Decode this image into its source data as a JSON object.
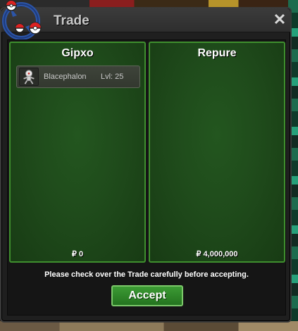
{
  "window": {
    "title": "Trade",
    "close_label": "✕"
  },
  "trade": {
    "left": {
      "name": "Gipxo",
      "items": [
        {
          "name": "Blacephalon",
          "level": "Lvl: 25",
          "icon": "blacephalon-sprite-icon"
        }
      ],
      "money": "₽ 0"
    },
    "right": {
      "name": "Repure",
      "items": [],
      "money": "₽ 4,000,000"
    }
  },
  "notice": "Please check over the Trade carefully before accepting.",
  "accept_label": "Accept",
  "colors": {
    "panel_green": "#1f4b1b",
    "panel_border": "#3f8f2e",
    "button_green": "#2f8a29"
  }
}
